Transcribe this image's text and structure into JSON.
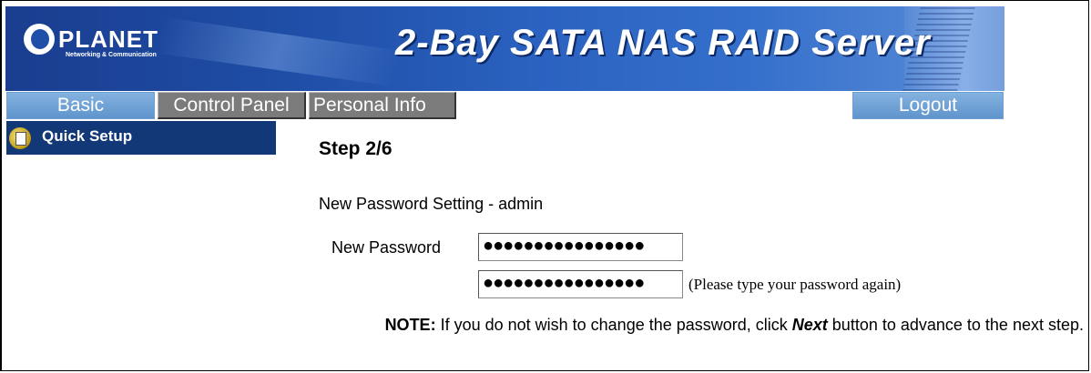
{
  "banner": {
    "logo_text": "PLANET",
    "logo_tagline": "Networking & Communication",
    "product_title": "2-Bay SATA NAS RAID Server"
  },
  "tabs": [
    {
      "label": "Basic",
      "active": true
    },
    {
      "label": "Control Panel",
      "active": false
    },
    {
      "label": "Personal Info",
      "active": false
    }
  ],
  "logout_label": "Logout",
  "sidebar": {
    "items": [
      {
        "label": "Quick Setup",
        "icon": "quick-setup-icon"
      }
    ]
  },
  "main": {
    "step_title": "Step 2/6",
    "section_title": "New Password Setting - admin",
    "new_password_label": "New Password",
    "new_password_value": "●●●●●●●●●●●●●●●●",
    "confirm_password_value": "●●●●●●●●●●●●●●●●",
    "retype_hint": "(Please type your password again)",
    "note": {
      "prefix": "NOTE:",
      "text_before": " If you do not wish to change the password, click ",
      "emphasis": "Next",
      "text_after": " button to advance to the next step."
    }
  },
  "colors": {
    "banner_blue": "#1f4fa8",
    "tab_active": "#6e9fd3",
    "tab_inactive": "#7b7b7b",
    "sidebar_bg": "#123877"
  }
}
